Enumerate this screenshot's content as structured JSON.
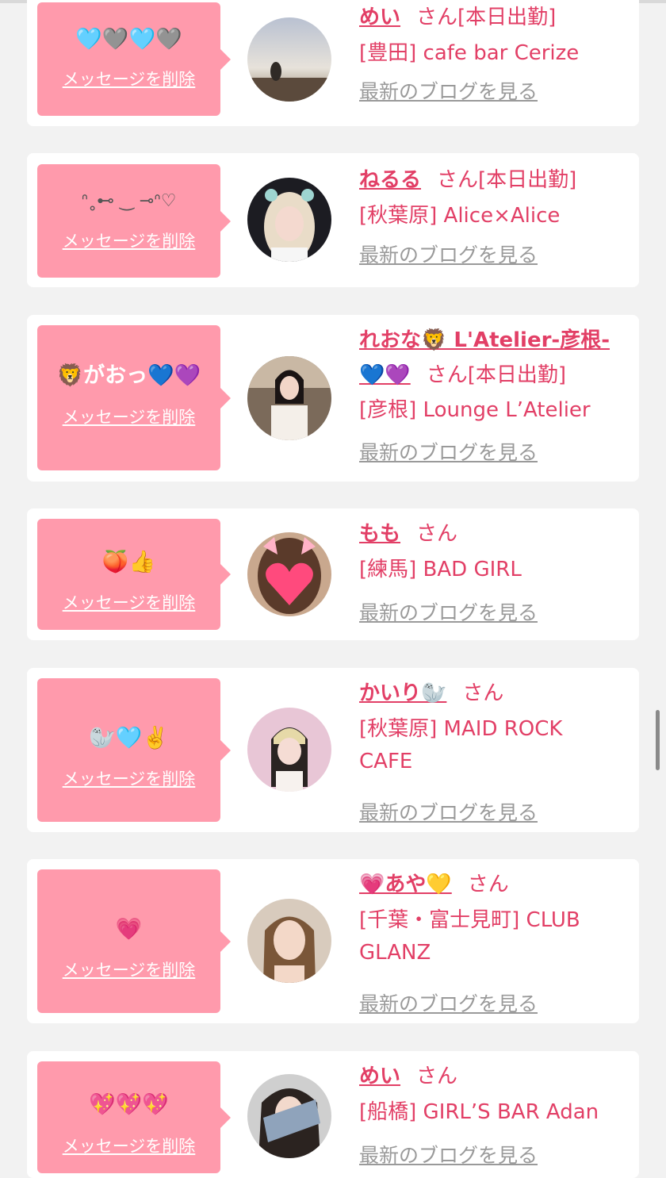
{
  "cards": [
    {
      "message": "🩵🩶🩵🩶",
      "delete_label": "メッセージを削除",
      "name": "めい",
      "san": "さん",
      "status": "[本日出勤]",
      "place": "[豊田] cafe bar Cerize",
      "blog_label": "最新のブログを見る"
    },
    {
      "message": "ᐢ˳⊷  ‿ ⊸ᐢ♡",
      "delete_label": "メッセージを削除",
      "name": "ねるる",
      "san": "さん",
      "status": "[本日出勤]",
      "place": "[秋葉原] Alice×Alice",
      "blog_label": "最新のブログを見る"
    },
    {
      "message": "🦁がおっ💙💜",
      "delete_label": "メッセージを削除",
      "name": "れおな🦁 L'Atelier-彦根-💙💜",
      "san": "さん",
      "status": "[本日出勤]",
      "place": "[彦根] Lounge L’Atelier",
      "blog_label": "最新のブログを見る"
    },
    {
      "message": "🍑👍",
      "delete_label": "メッセージを削除",
      "name": "もも",
      "san": "さん",
      "status": "",
      "place": "[練馬] BAD GIRL",
      "blog_label": "最新のブログを見る"
    },
    {
      "message": "🦭🩵✌️",
      "delete_label": "メッセージを削除",
      "name": "かいり🦭",
      "san": "さん",
      "status": "",
      "place": "[秋葉原] MAID ROCK CAFE",
      "blog_label": "最新のブログを見る"
    },
    {
      "message": "💗",
      "delete_label": "メッセージを削除",
      "name": "💗あや💛",
      "san": "さん",
      "status": "",
      "place": "[千葉・富士見町] CLUB GLANZ",
      "blog_label": "最新のブログを見る"
    },
    {
      "message": "💖💖💖",
      "delete_label": "メッセージを削除",
      "name": "めい",
      "san": "さん",
      "status": "",
      "place": "[船橋] GIRL’S BAR Adan",
      "blog_label": "最新のブログを見る"
    }
  ],
  "colors": {
    "background": "#f2f2f2",
    "card": "#ffffff",
    "bubble": "#ff9aac",
    "accent": "#e23f66",
    "muted_link": "#9a9a9a"
  }
}
